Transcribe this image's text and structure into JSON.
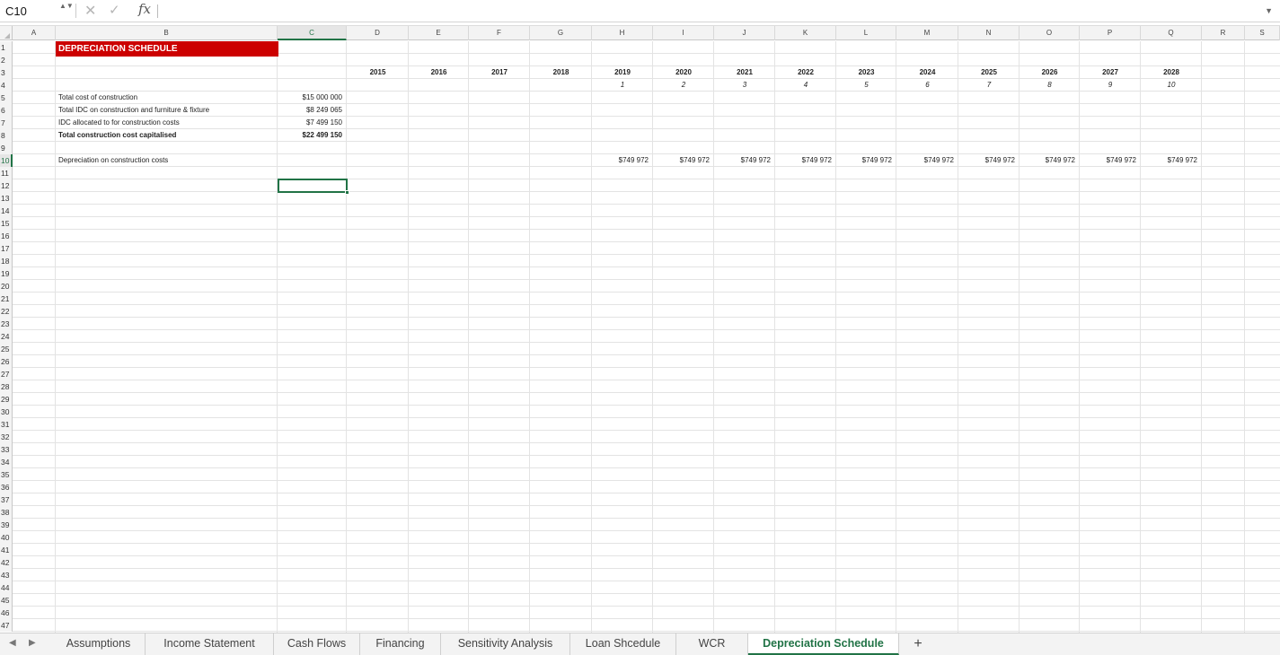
{
  "formula_bar": {
    "name_box": "C10",
    "formula": "",
    "fx_label": "fx",
    "cancel_glyph": "✕",
    "enter_glyph": "✓",
    "arrows_glyph": "▲▼",
    "expand_glyph": "▼"
  },
  "columns": [
    "A",
    "B",
    "C",
    "D",
    "E",
    "F",
    "G",
    "H",
    "I",
    "J",
    "K",
    "L",
    "M",
    "N",
    "O",
    "P",
    "Q",
    "R",
    "S"
  ],
  "active_column": "C",
  "active_row": 10,
  "rows": 47,
  "sheet": {
    "title": "DEPRECIATION SCHEDULE",
    "years": [
      "2015",
      "2016",
      "2017",
      "2018",
      "2019",
      "2020",
      "2021",
      "2022",
      "2023",
      "2024",
      "2025",
      "2026",
      "2027",
      "2028"
    ],
    "period_numbers": [
      "1",
      "2",
      "3",
      "4",
      "5",
      "6",
      "7",
      "8",
      "9",
      "10"
    ],
    "labels": {
      "total_cost": "Total cost of construction",
      "total_idc": "Total IDC on construction and furniture & fixture",
      "idc_allocated": "IDC allocated to for construction costs",
      "total_capitalised": "Total construction cost capitalised",
      "depreciation": "Depreciation on construction costs"
    },
    "values": {
      "total_cost": "$15 000 000",
      "total_idc": "$8 249 065",
      "idc_allocated": "$7 499 150",
      "total_capitalised": "$22 499 150"
    },
    "depreciation_values": [
      "$749 972",
      "$749 972",
      "$749 972",
      "$749 972",
      "$749 972",
      "$749 972",
      "$749 972",
      "$749 972",
      "$749 972",
      "$749 972"
    ]
  },
  "tabs": {
    "prev_glyph": "◀",
    "next_glyph": "▶",
    "items": [
      "Assumptions",
      "Income Statement",
      "Cash Flows",
      "Financing",
      "Sensitivity Analysis",
      "Loan Shcedule",
      "WCR",
      "Depreciation Schedule"
    ],
    "active": "Depreciation Schedule",
    "add_label": "+"
  },
  "colors": {
    "accent": "#217346",
    "title_fill": "#cc0000"
  }
}
